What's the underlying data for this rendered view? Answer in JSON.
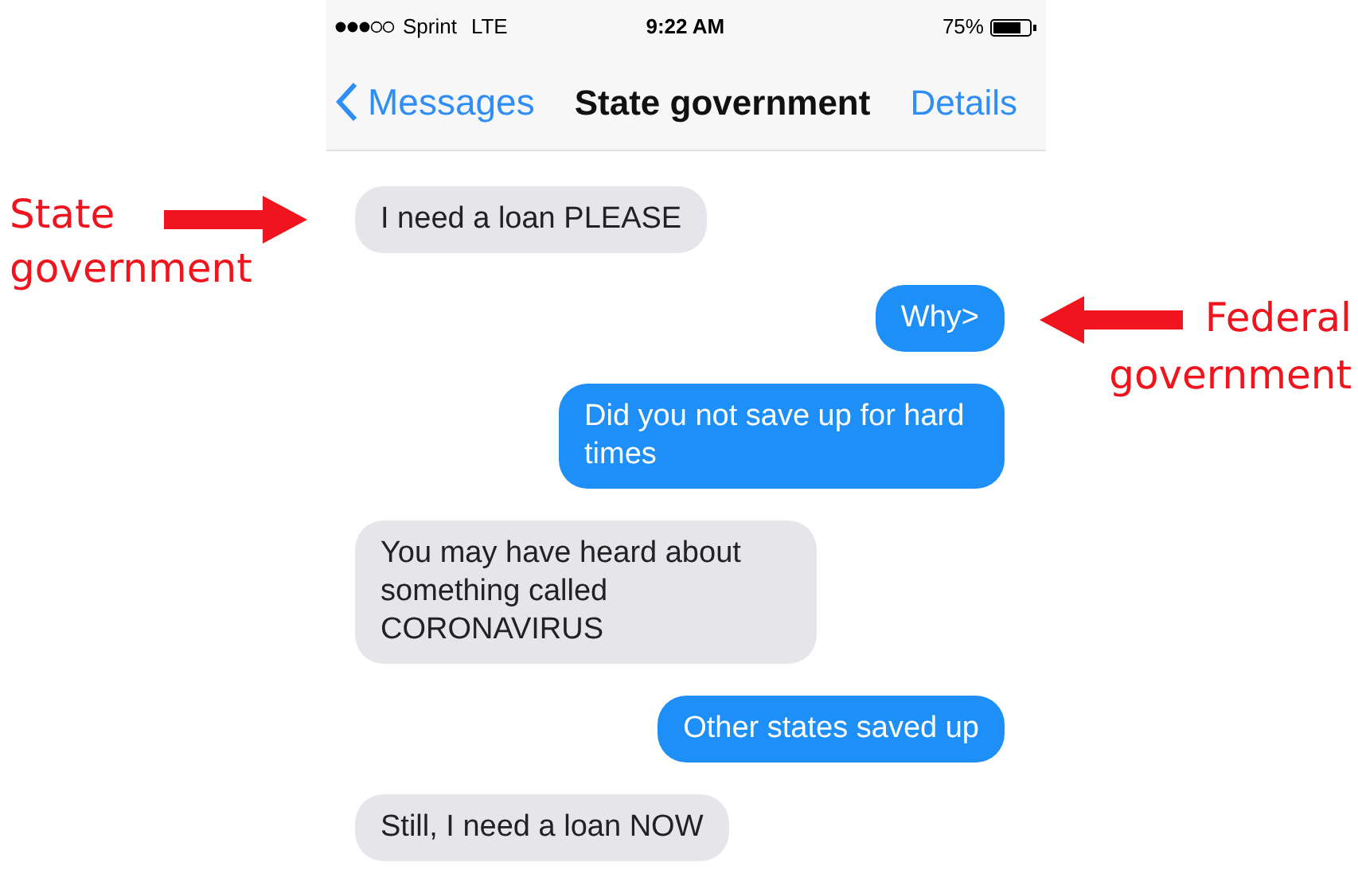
{
  "status_bar": {
    "carrier": "Sprint",
    "network": "LTE",
    "time": "9:22 AM",
    "battery": "75%"
  },
  "nav": {
    "back": "Messages",
    "title": "State government",
    "action": "Details"
  },
  "messages": [
    {
      "kind": "received",
      "text": "I need a loan PLEASE"
    },
    {
      "kind": "sent",
      "text": "Why>"
    },
    {
      "kind": "sent",
      "text": "Did you not save up for hard times"
    },
    {
      "kind": "received",
      "text": "You may have heard about something called CORONAVIRUS"
    },
    {
      "kind": "sent",
      "text": "Other states saved up"
    },
    {
      "kind": "received",
      "text": "Still, I need a loan NOW"
    }
  ],
  "annotations": [
    {
      "kind": "points_right",
      "lines": [
        "State",
        "government"
      ]
    },
    {
      "kind": "points_left",
      "lines": [
        "Federal",
        "government"
      ]
    }
  ]
}
